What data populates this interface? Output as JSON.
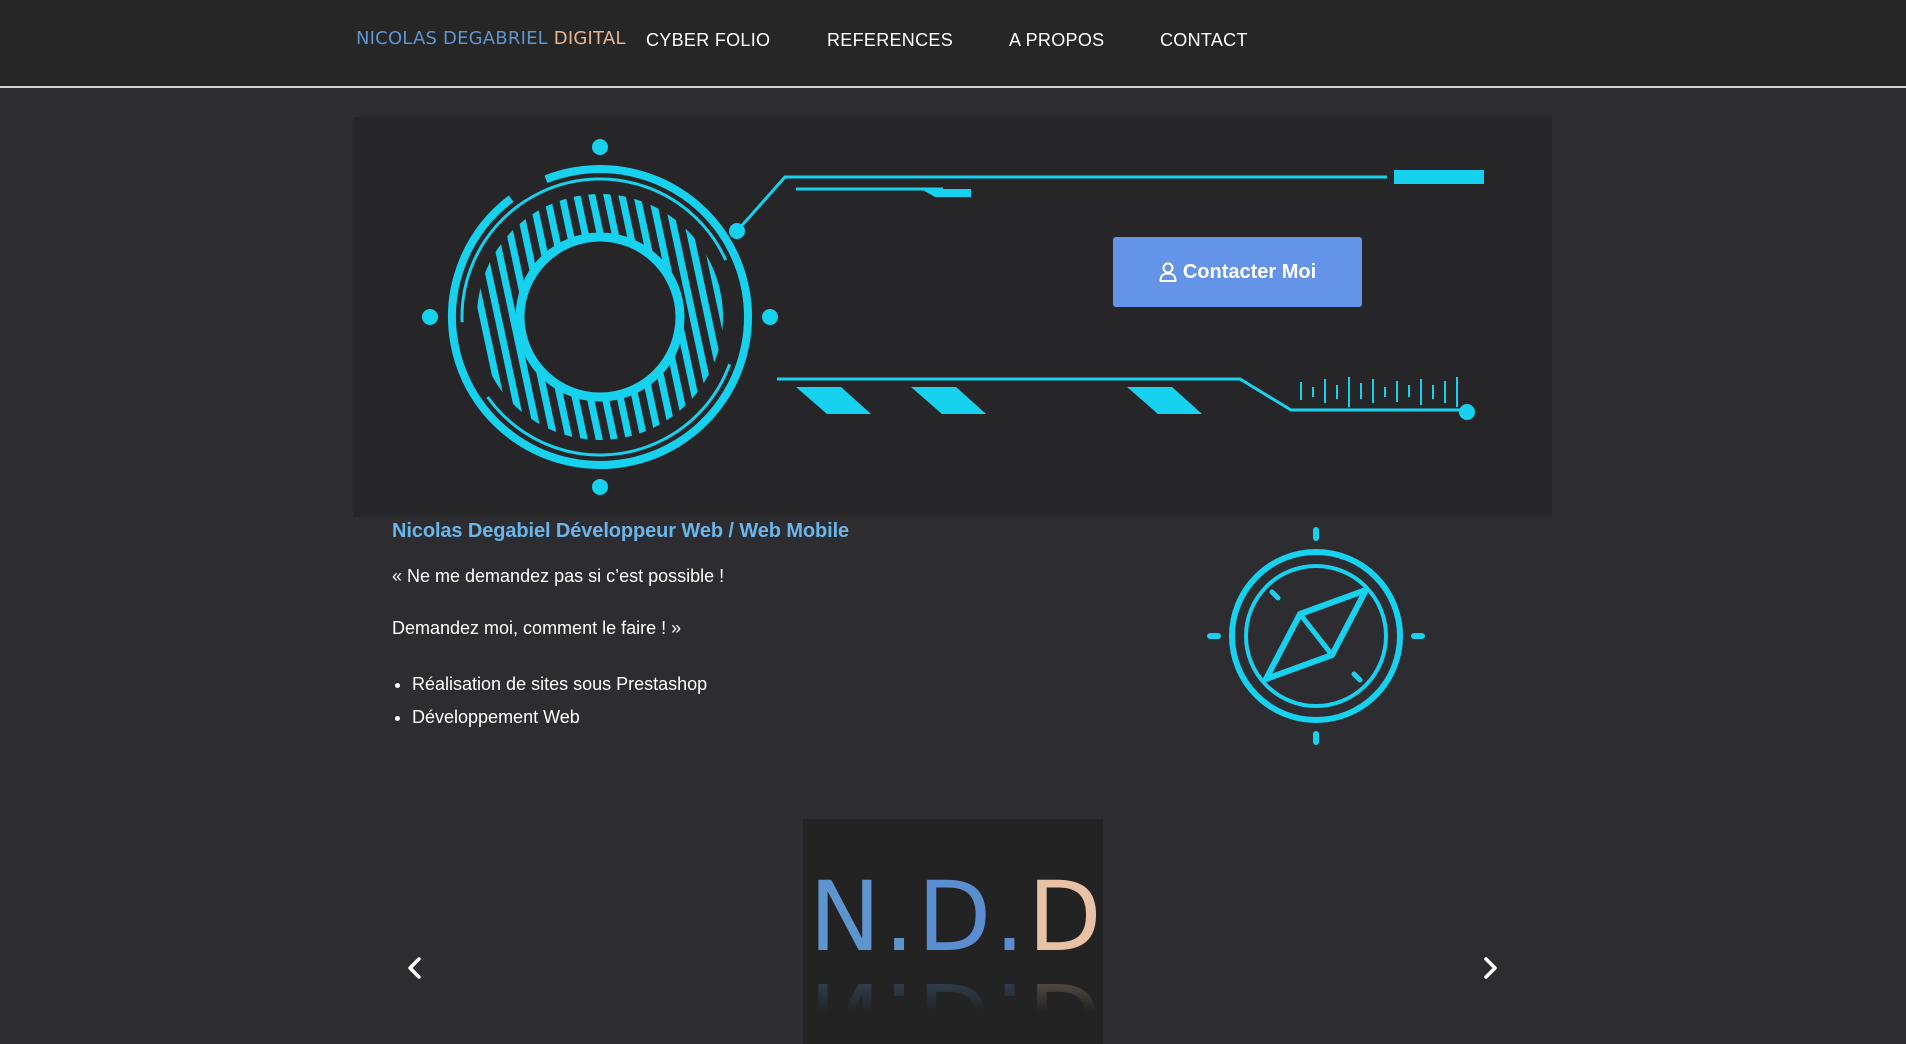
{
  "header": {
    "logo_part1": "NICOLAS DEGABRIEL",
    "logo_part2": "DIGITAL",
    "nav": [
      "CYBER FOLIO",
      "REFERENCES",
      "A PROPOS",
      "CONTACT"
    ]
  },
  "hero": {
    "button_label": "Contacter Moi",
    "button_icon": "user-icon"
  },
  "intro": {
    "heading": "Nicolas Degabiel Développeur Web / Web Mobile",
    "quote_line1": "« Ne me demandez pas si c’est possible !",
    "quote_line2": "Demandez moi, comment le faire ! »",
    "bullets": [
      "Réalisation de sites sous Prestashop",
      "Développement Web"
    ]
  },
  "carousel": {
    "slide_text": [
      "N",
      ".",
      "D",
      ".",
      "D",
      "."
    ],
    "prev_icon": "chevron-left-icon",
    "next_icon": "chevron-right-icon"
  },
  "colors": {
    "accent_cyan": "#16d2ee",
    "button_blue": "#6494e8",
    "heading_blue": "#6ab5ea",
    "logo_blue": "#5f95cf",
    "logo_peach": "#e8b58f",
    "page_bg": "#2d2c31",
    "header_bg": "#262626"
  }
}
